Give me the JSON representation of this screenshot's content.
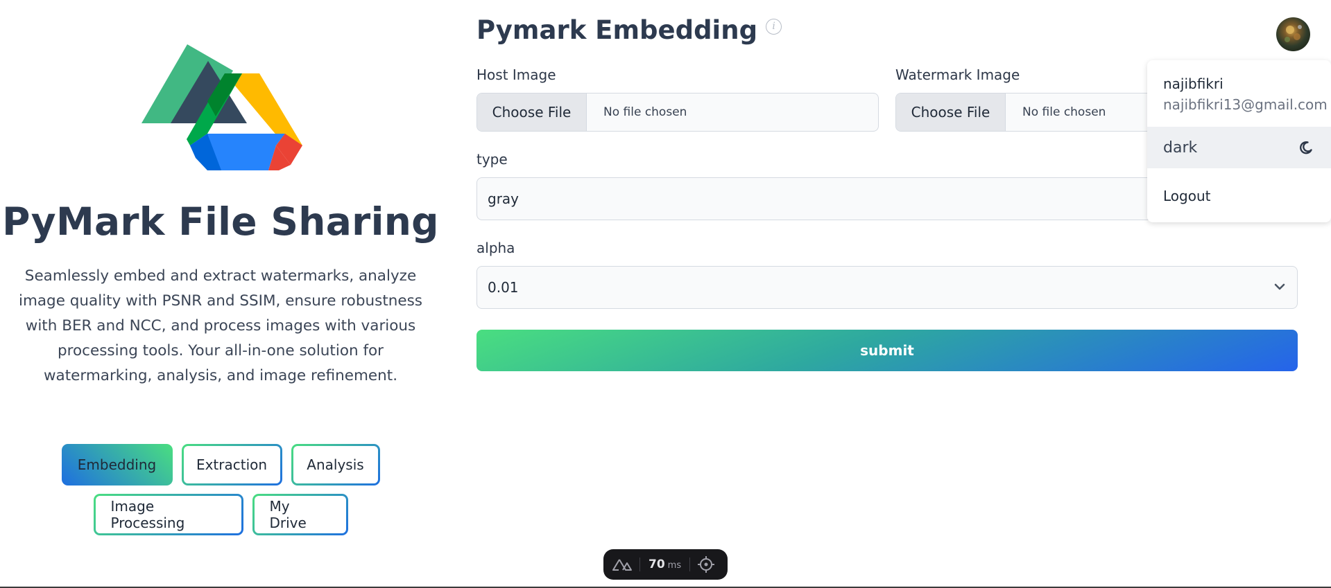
{
  "brand": {
    "title": "PyMark File Sharing",
    "description": "Seamlessly embed and extract watermarks, analyze image quality with PSNR and SSIM, ensure robustness with BER and NCC, and process images with various processing tools. Your all-in-one solution for watermarking, analysis, and image refinement."
  },
  "nav": {
    "items": [
      {
        "label": "Embedding",
        "active": true
      },
      {
        "label": "Extraction",
        "active": false
      },
      {
        "label": "Analysis",
        "active": false
      },
      {
        "label": "Image Processing",
        "active": false
      },
      {
        "label": "My Drive",
        "active": false
      }
    ]
  },
  "form": {
    "title": "Pymark Embedding",
    "info_glyph": "i",
    "host_image": {
      "label": "Host Image",
      "button": "Choose File",
      "status": "No file chosen"
    },
    "watermark_image": {
      "label": "Watermark Image",
      "button": "Choose File",
      "status": "No file chosen"
    },
    "type": {
      "label": "type",
      "value": "gray"
    },
    "alpha": {
      "label": "alpha",
      "value": "0.01"
    },
    "submit_label": "submit"
  },
  "user_menu": {
    "username": "najibfikri",
    "email": "najibfikri13@gmail.com",
    "theme_label": "dark",
    "logout_label": "Logout"
  },
  "devtools": {
    "timing_value": "70",
    "timing_unit": "ms"
  },
  "colors": {
    "accent_green": "#4ade80",
    "accent_blue": "#2563eb",
    "heading": "#2d3a4f"
  },
  "icons": [
    "nuxt-drive-logo",
    "info-icon",
    "chevron-down-icon",
    "moon-icon",
    "nuxt-icon",
    "crosshair-icon"
  ]
}
